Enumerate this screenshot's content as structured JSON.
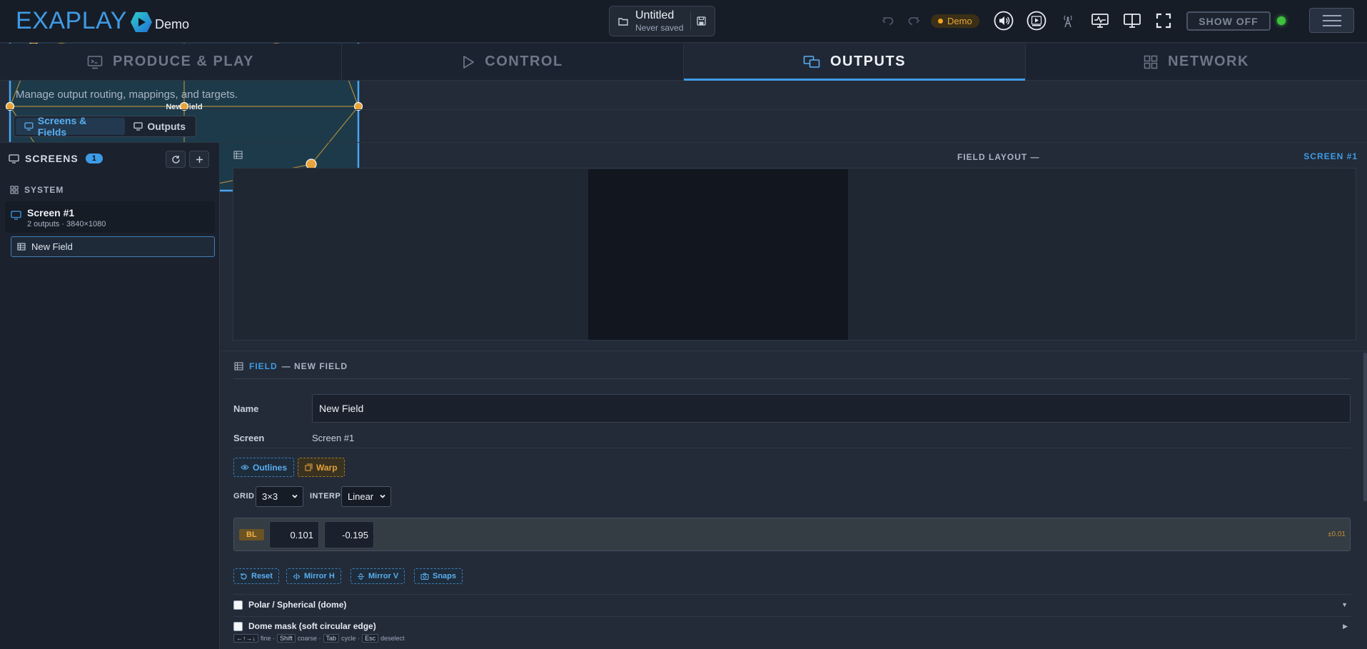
{
  "brand": {
    "name": "EXAPLAY",
    "edition": "Demo"
  },
  "file": {
    "title": "Untitled",
    "status": "Never saved"
  },
  "toolbar": {
    "demo_label": "Demo",
    "show_off_label": "SHOW OFF"
  },
  "tabs": [
    {
      "label": "PRODUCE & PLAY",
      "icon": "monitor-play-icon",
      "active": false
    },
    {
      "label": "CONTROL",
      "icon": "play-icon",
      "active": false
    },
    {
      "label": "OUTPUTS",
      "icon": "outputs-icon",
      "active": true
    },
    {
      "label": "NETWORK",
      "icon": "network-grid-icon",
      "active": false
    }
  ],
  "subtitle": "Manage output routing, mappings, and targets.",
  "segments": [
    {
      "label": "Screens & Fields",
      "active": true
    },
    {
      "label": "Outputs",
      "active": false
    }
  ],
  "sidebar": {
    "title": "SCREENS",
    "count": "1",
    "system_label": "SYSTEM",
    "screen": {
      "name": "Screen #1",
      "meta": "2 outputs · 3840×1080"
    },
    "field": {
      "name": "New Field"
    }
  },
  "canvas": {
    "title": "FIELD LAYOUT —",
    "screen_label": "SCREEN #1",
    "field_label": "New Field"
  },
  "field_panel": {
    "prefix": "FIELD",
    "suffix": "— NEW FIELD",
    "name_label": "Name",
    "name_value": "New Field",
    "screen_label": "Screen",
    "screen_value": "Screen #1",
    "outlines_label": "Outlines",
    "warp_label": "Warp",
    "grid_label": "GRID",
    "grid_value": "3×3",
    "interp_label": "INTERP",
    "interp_value": "Linear",
    "corner": {
      "tag": "BL",
      "x": "0.101",
      "y": "-0.195",
      "step": "±0.01"
    },
    "actions": {
      "reset": "Reset",
      "mirror_h": "Mirror H",
      "mirror_v": "Mirror V",
      "snaps": "Snaps"
    },
    "polar_label": "Polar / Spherical (dome)",
    "dome_label": "Dome mask (soft circular edge)",
    "hints": {
      "arrows": "←↑→↓",
      "fine": "fine ·",
      "shift": "Shift",
      "coarse": "coarse ·",
      "tab": "Tab",
      "cycle": "cycle ·",
      "esc": "Esc",
      "deselect": "deselect"
    }
  }
}
